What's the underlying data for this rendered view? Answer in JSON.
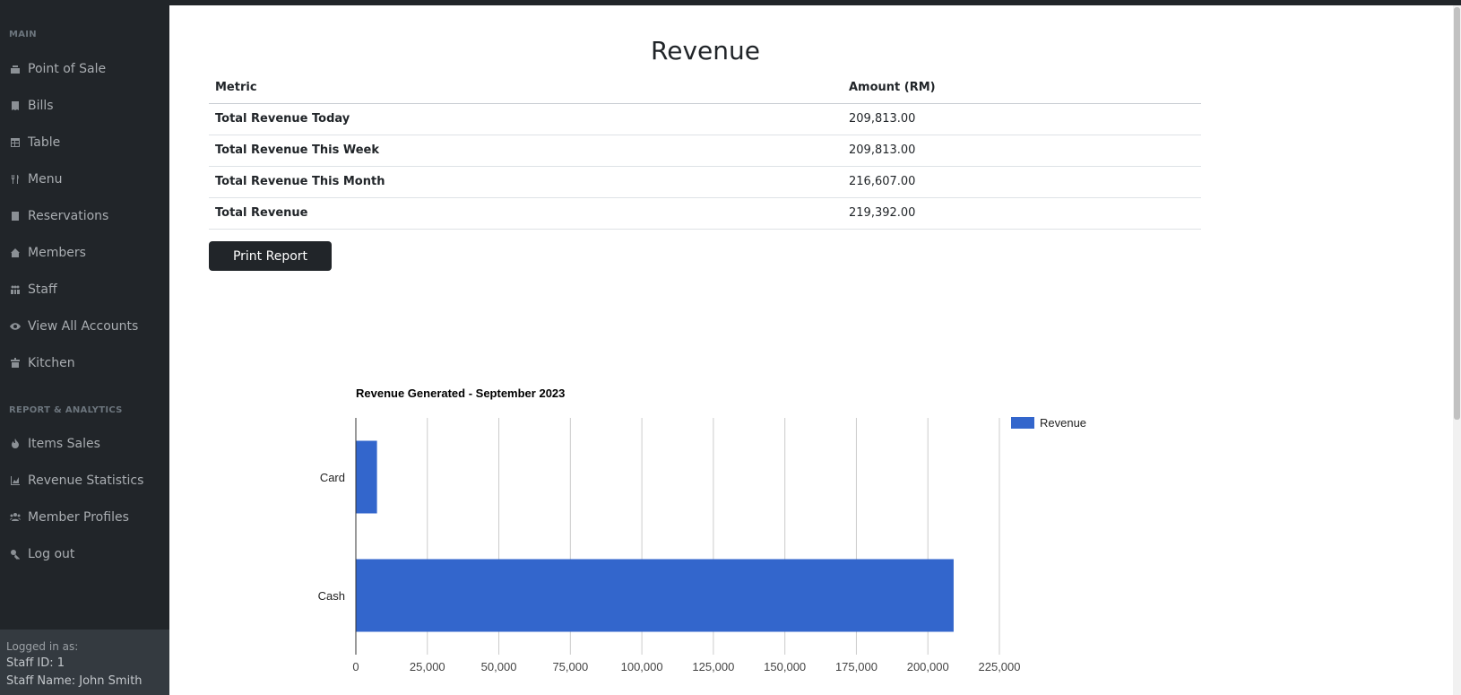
{
  "sidebar": {
    "sections": [
      {
        "label": "MAIN"
      },
      {
        "label": "REPORT & ANALYTICS"
      }
    ],
    "main_items": [
      {
        "label": "Point of Sale",
        "icon": "cash-register-icon"
      },
      {
        "label": "Bills",
        "icon": "receipt-icon"
      },
      {
        "label": "Table",
        "icon": "table-icon"
      },
      {
        "label": "Menu",
        "icon": "utensils-icon"
      },
      {
        "label": "Reservations",
        "icon": "book-icon"
      },
      {
        "label": "Members",
        "icon": "house-user-icon"
      },
      {
        "label": "Staff",
        "icon": "people-icon"
      },
      {
        "label": "View All Accounts",
        "icon": "eye-icon"
      },
      {
        "label": "Kitchen",
        "icon": "kitchen-icon"
      }
    ],
    "report_items": [
      {
        "label": "Items Sales",
        "icon": "fire-icon"
      },
      {
        "label": "Revenue Statistics",
        "icon": "chart-area-icon"
      },
      {
        "label": "Member Profiles",
        "icon": "users-icon"
      },
      {
        "label": "Log out",
        "icon": "key-icon"
      }
    ],
    "footer": {
      "caption": "Logged in as:",
      "staff_id": "Staff ID: 1",
      "staff_name": "Staff Name: John Smith"
    }
  },
  "page": {
    "title": "Revenue",
    "print_button": "Print Report"
  },
  "revenue_table": {
    "headers": [
      "Metric",
      "Amount (RM)"
    ],
    "rows": [
      {
        "metric": "Total Revenue Today",
        "amount": "209,813.00"
      },
      {
        "metric": "Total Revenue This Week",
        "amount": "209,813.00"
      },
      {
        "metric": "Total Revenue This Month",
        "amount": "216,607.00"
      },
      {
        "metric": "Total Revenue",
        "amount": "219,392.00"
      }
    ]
  },
  "colors": {
    "sidebar_bg": "#212529",
    "bar": "#3366cc",
    "button_bg": "#212529"
  },
  "chart_data": {
    "type": "bar",
    "orientation": "horizontal",
    "title": "Revenue Generated - September 2023",
    "categories": [
      "Card",
      "Cash"
    ],
    "series": [
      {
        "name": "Revenue",
        "values": [
          7400,
          209000
        ],
        "color": "#3366cc"
      }
    ],
    "xlim": [
      0,
      225000
    ],
    "x_ticks": [
      0,
      25000,
      50000,
      75000,
      100000,
      125000,
      150000,
      175000,
      200000,
      225000
    ],
    "x_tick_labels": [
      "0",
      "25,000",
      "50,000",
      "75,000",
      "100,000",
      "125,000",
      "150,000",
      "175,000",
      "200,000",
      "225,000"
    ],
    "grid": true,
    "legend": "right"
  }
}
